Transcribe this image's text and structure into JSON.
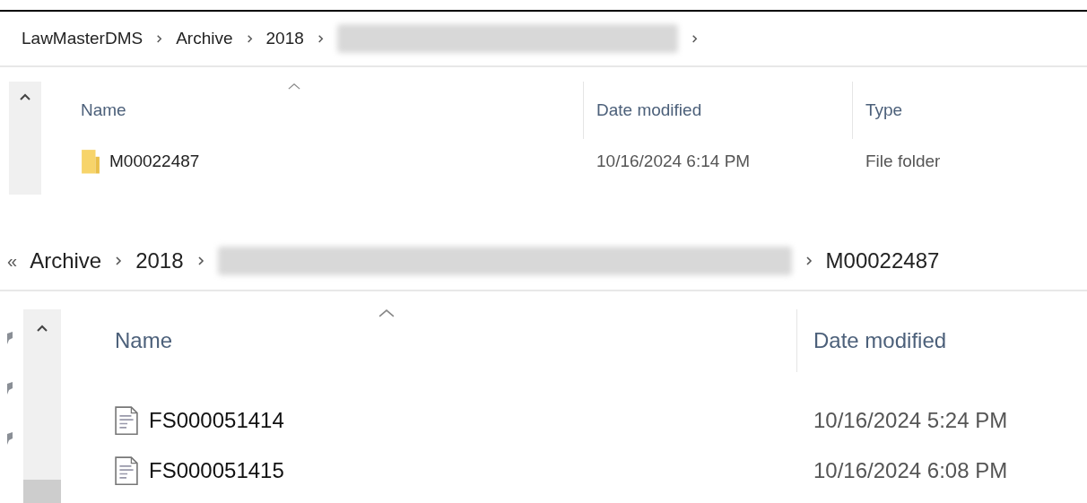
{
  "top_window": {
    "breadcrumb": [
      {
        "kind": "folder",
        "label": "LawMasterDMS"
      },
      {
        "kind": "folder",
        "label": "Archive"
      },
      {
        "kind": "folder",
        "label": "2018"
      },
      {
        "kind": "redacted"
      }
    ],
    "columns": [
      "Name",
      "Date modified",
      "Type"
    ],
    "rows": [
      {
        "kind": "folder",
        "name": "M00022487",
        "date": "10/16/2024 6:14 PM",
        "type": "File folder"
      }
    ]
  },
  "bottom_window": {
    "overflow": "«",
    "breadcrumb": [
      {
        "kind": "folder",
        "label": "Archive"
      },
      {
        "kind": "folder",
        "label": "2018"
      },
      {
        "kind": "redacted"
      },
      {
        "kind": "folder",
        "label": "M00022487"
      }
    ],
    "columns": [
      "Name",
      "Date modified"
    ],
    "rows": [
      {
        "kind": "file",
        "name": "FS000051414",
        "date": "10/16/2024 5:24 PM"
      },
      {
        "kind": "file",
        "name": "FS000051415",
        "date": "10/16/2024 6:08 PM"
      }
    ]
  }
}
